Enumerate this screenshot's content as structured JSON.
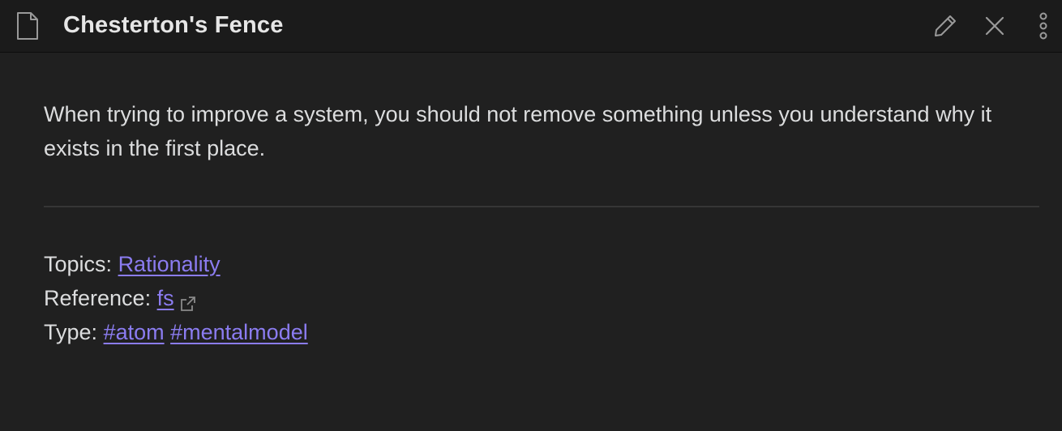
{
  "note": {
    "title": "Chesterton's Fence",
    "body": "When trying to improve a system, you should not remove something unless you understand why it exists in the first place."
  },
  "toolbar": {
    "icons": [
      "file-icon",
      "pencil-icon",
      "close-icon",
      "more-vertical-icon"
    ]
  },
  "metadata": {
    "topics_label": "Topics:",
    "topics_link": "Rationality",
    "reference_label": "Reference:",
    "reference_link": "fs",
    "type_label": "Type:",
    "tags": [
      "#atom",
      "#mentalmodel"
    ]
  },
  "colors": {
    "background": "#202020",
    "titlebar": "#1b1b1b",
    "text": "#dcddde",
    "link": "#8b7cf0",
    "icon": "#9a9a9a",
    "divider": "#363636"
  }
}
